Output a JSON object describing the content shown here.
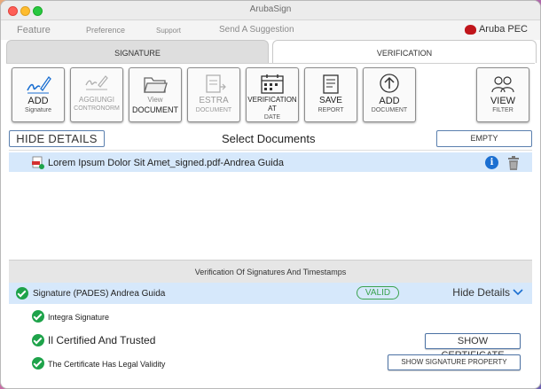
{
  "window": {
    "title": "ArubaSign"
  },
  "menu": {
    "items": [
      "Feature",
      "Preference",
      "Support",
      "Send A Suggestion"
    ],
    "account": "Aruba PEC"
  },
  "tabs": [
    {
      "label": "SIGNATURE",
      "active": false
    },
    {
      "label": "VERIFICATION",
      "active": true
    }
  ],
  "toolbar": {
    "tools": [
      {
        "line1": "ADD",
        "line2": "Signature",
        "icon": "signature-pen-icon",
        "enabled": true
      },
      {
        "line1": "AGGIUNGI",
        "line2": "CONTRONORM",
        "icon": "countersign-icon",
        "enabled": false
      },
      {
        "line1": "View",
        "line2": "DOCUMENT",
        "icon": "open-folder-icon",
        "enabled": true
      },
      {
        "line1": "ESTRA",
        "line2": "DOCUMENT",
        "icon": "extract-document-icon",
        "enabled": false
      },
      {
        "line1": "VERIFICATION AT",
        "line2": "DATE",
        "icon": "calendar-icon",
        "enabled": true
      },
      {
        "line1": "SAVE",
        "line2": "REPORT",
        "icon": "report-icon",
        "enabled": true
      },
      {
        "line1": "ADD",
        "line2": "DOCUMENT",
        "icon": "upload-icon",
        "enabled": true
      },
      {
        "line1": "VIEW",
        "line2": "FILTER",
        "icon": "users-icon",
        "enabled": true
      }
    ]
  },
  "documents": {
    "hide_details_label": "HIDE DETAILS",
    "heading": "Select Documents",
    "empty_label": "EMPTY",
    "items": [
      {
        "name": "Lorem Ipsum Dolor Sit Amet_signed.pdf-Andrea Guida"
      }
    ]
  },
  "verification": {
    "heading": "Verification Of Signatures And Timestamps",
    "signature": {
      "label": "Signature (PADES) Andrea Guida",
      "status": "VALID",
      "toggle_label": "Hide Details"
    },
    "details": [
      {
        "text": "Integra Signature"
      },
      {
        "text": "Il Certified And Trusted"
      },
      {
        "text": "The Certificate Has Legal Validity"
      }
    ],
    "show_certificate_label": "SHOW CERTIFICATE",
    "show_signature_property_label": "SHOW SIGNATURE PROPERTY"
  },
  "colors": {
    "accent_blue": "#1b6fd1",
    "valid_green": "#1ea34a",
    "selection": "#d6e8fb",
    "brand_red": "#c0151b"
  }
}
